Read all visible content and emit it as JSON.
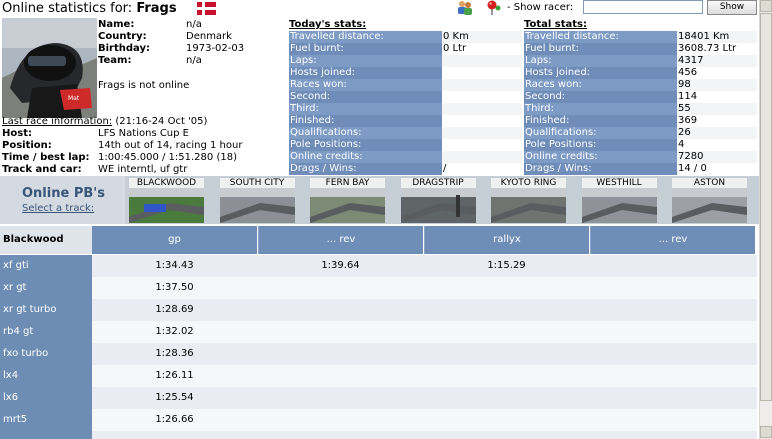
{
  "header": {
    "title_prefix": "Online statistics for: ",
    "racer_name": "Frags",
    "show_racer_label": "- Show racer:",
    "racer_input_value": "",
    "show_button": "Show"
  },
  "profile": {
    "name_label": "Name:",
    "name": "n/a",
    "country_label": "Country:",
    "country": "Denmark",
    "birthday_label": "Birthday:",
    "birthday": "1973-02-03",
    "team_label": "Team:",
    "team": "n/a",
    "online_status": "Frags is not online",
    "last_race_label": "Last race information:",
    "last_race_time": "(21:16-24 Oct '05)",
    "host_label": "Host:",
    "host": "LFS Nations Cup E",
    "position_label": "Position:",
    "position": "14th out of 14, racing 1 hour",
    "time_label": "Time / best lap:",
    "time": "1:00:45.000 / 1:51.280 (18)",
    "track_label": "Track and car:",
    "track": "WE interntl, uf gtr"
  },
  "today_stats": {
    "heading": "Today's stats:",
    "rows": [
      {
        "label": "Travelled distance:",
        "value": "0 Km"
      },
      {
        "label": "Fuel burnt:",
        "value": "0 Ltr"
      },
      {
        "label": "Laps:",
        "value": ""
      },
      {
        "label": "Hosts joined:",
        "value": ""
      },
      {
        "label": "Races won:",
        "value": ""
      },
      {
        "label": "Second:",
        "value": ""
      },
      {
        "label": "Third:",
        "value": ""
      },
      {
        "label": "Finished:",
        "value": ""
      },
      {
        "label": "Qualifications:",
        "value": ""
      },
      {
        "label": "Pole Positions:",
        "value": ""
      },
      {
        "label": "Online credits:",
        "value": ""
      },
      {
        "label": "Drags / Wins:",
        "value": "/"
      }
    ]
  },
  "total_stats": {
    "heading": "Total stats:",
    "rows": [
      {
        "label": "Travelled distance:",
        "value": "18401 Km"
      },
      {
        "label": "Fuel burnt:",
        "value": "3608.73 Ltr"
      },
      {
        "label": "Laps:",
        "value": "4317"
      },
      {
        "label": "Hosts joined:",
        "value": "456"
      },
      {
        "label": "Races won:",
        "value": "98"
      },
      {
        "label": "Second:",
        "value": "114"
      },
      {
        "label": "Third:",
        "value": "55"
      },
      {
        "label": "Finished:",
        "value": "369"
      },
      {
        "label": "Qualifications:",
        "value": "26"
      },
      {
        "label": "Pole Positions:",
        "value": "4"
      },
      {
        "label": "Online credits:",
        "value": "7280"
      },
      {
        "label": "Drags / Wins:",
        "value": "14 / 0"
      }
    ]
  },
  "pb": {
    "title": "Online PB's",
    "select_link": "Select a track:",
    "tracks": [
      "BLACKWOOD",
      "SOUTH CITY",
      "FERN BAY",
      "DRAGSTRIP",
      "KYOTO RING",
      "WESTHILL",
      "ASTON"
    ],
    "selected_track": "BLACKWOOD"
  },
  "table": {
    "track_heading": "Blackwood",
    "columns": [
      "gp",
      "... rev",
      "rallyx",
      "... rev"
    ],
    "rows": [
      {
        "car": "xf gti",
        "times": [
          "1:34.43",
          "1:39.64",
          "1:15.29",
          ""
        ]
      },
      {
        "car": "xr gt",
        "times": [
          "1:37.50",
          "",
          "",
          ""
        ]
      },
      {
        "car": "xr gt turbo",
        "times": [
          "1:28.69",
          "",
          "",
          ""
        ]
      },
      {
        "car": "rb4 gt",
        "times": [
          "1:32.02",
          "",
          "",
          ""
        ]
      },
      {
        "car": "fxo turbo",
        "times": [
          "1:28.36",
          "",
          "",
          ""
        ]
      },
      {
        "car": "lx4",
        "times": [
          "1:26.11",
          "",
          "",
          ""
        ]
      },
      {
        "car": "lx6",
        "times": [
          "1:25.54",
          "",
          "",
          ""
        ]
      },
      {
        "car": "mrt5",
        "times": [
          "1:26.66",
          "",
          "",
          ""
        ]
      },
      {
        "car": "",
        "times": [
          "",
          "",
          "",
          ""
        ]
      }
    ]
  },
  "colors": {
    "stat_label_bg": "#7d9bc4",
    "stat_label_bg_alt": "#6f8db8",
    "header_col_bg": "#6f8eb7",
    "row_even": "#e9ecf0",
    "row_odd": "#f6f7f8",
    "pb_title": "#39557a"
  }
}
